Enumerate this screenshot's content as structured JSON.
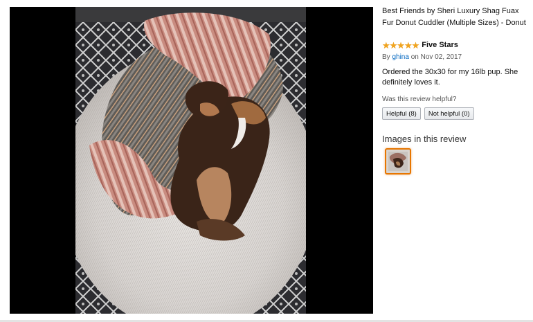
{
  "product": {
    "title": "Best Friends by Sheri Luxury Shag Fuax Fur Donut Cuddler (Multiple Sizes) - Donut"
  },
  "review": {
    "rating": 5,
    "rating_max": 5,
    "stars": "★★★★★",
    "title": "Five Stars",
    "by_prefix": "By ",
    "author": "ghina",
    "date_prefix": " on ",
    "date": "Nov 02, 2017",
    "body": "Ordered the 30x30 for my 16lb pup. She definitely loves it.",
    "helpful_question": "Was this review helpful?",
    "helpful_label": "Helpful (8)",
    "not_helpful_label": "Not helpful (0)"
  },
  "images_section": {
    "heading": "Images in this review"
  },
  "colors": {
    "star": "#f0a41f",
    "link": "#0066c0",
    "thumb_border": "#e77600",
    "viewer_bg": "#000000"
  }
}
